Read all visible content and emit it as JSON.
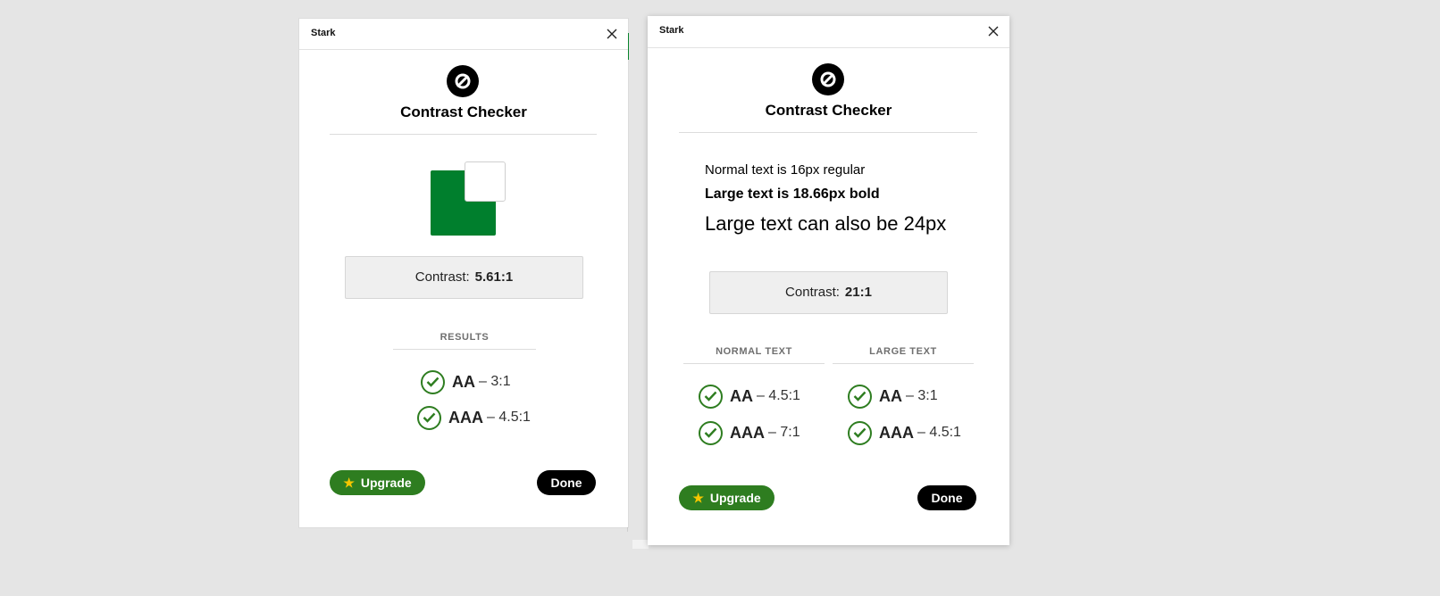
{
  "colors": {
    "page_background": "#e5e5e5",
    "foreground_swatch": "#007f2d",
    "background_swatch": "#ffffff",
    "pass_green": "#2e7d20",
    "upgrade_green": "#2e7d20",
    "done_black": "#000000"
  },
  "left_panel": {
    "app_title": "Stark",
    "close_icon": "close-icon",
    "logo_icon": "stark-logo-icon",
    "heading": "Contrast Checker",
    "contrast_label": "Contrast:",
    "contrast_value": "5.61:1",
    "results_label": "RESULTS",
    "results": [
      {
        "level": "AA",
        "ratio": "– 3:1",
        "status_icon": "check-icon"
      },
      {
        "level": "AAA",
        "ratio": "– 4.5:1",
        "status_icon": "check-icon"
      }
    ],
    "upgrade_label": "Upgrade",
    "done_label": "Done"
  },
  "right_panel": {
    "app_title": "Stark",
    "close_icon": "close-icon",
    "logo_icon": "stark-logo-icon",
    "heading": "Contrast Checker",
    "samples": {
      "normal": "Normal text is 16px regular",
      "large_bold": "Large text is 18.66px bold",
      "large_24": "Large text can also be 24px"
    },
    "contrast_label": "Contrast:",
    "contrast_value": "21:1",
    "normal_text_label": "NORMAL TEXT",
    "large_text_label": "LARGE TEXT",
    "normal_results": [
      {
        "level": "AA",
        "ratio": "– 4.5:1",
        "status_icon": "check-icon"
      },
      {
        "level": "AAA",
        "ratio": "– 7:1",
        "status_icon": "check-icon"
      }
    ],
    "large_results": [
      {
        "level": "AA",
        "ratio": "– 3:1",
        "status_icon": "check-icon"
      },
      {
        "level": "AAA",
        "ratio": "– 4.5:1",
        "status_icon": "check-icon"
      }
    ],
    "upgrade_label": "Upgrade",
    "done_label": "Done"
  }
}
